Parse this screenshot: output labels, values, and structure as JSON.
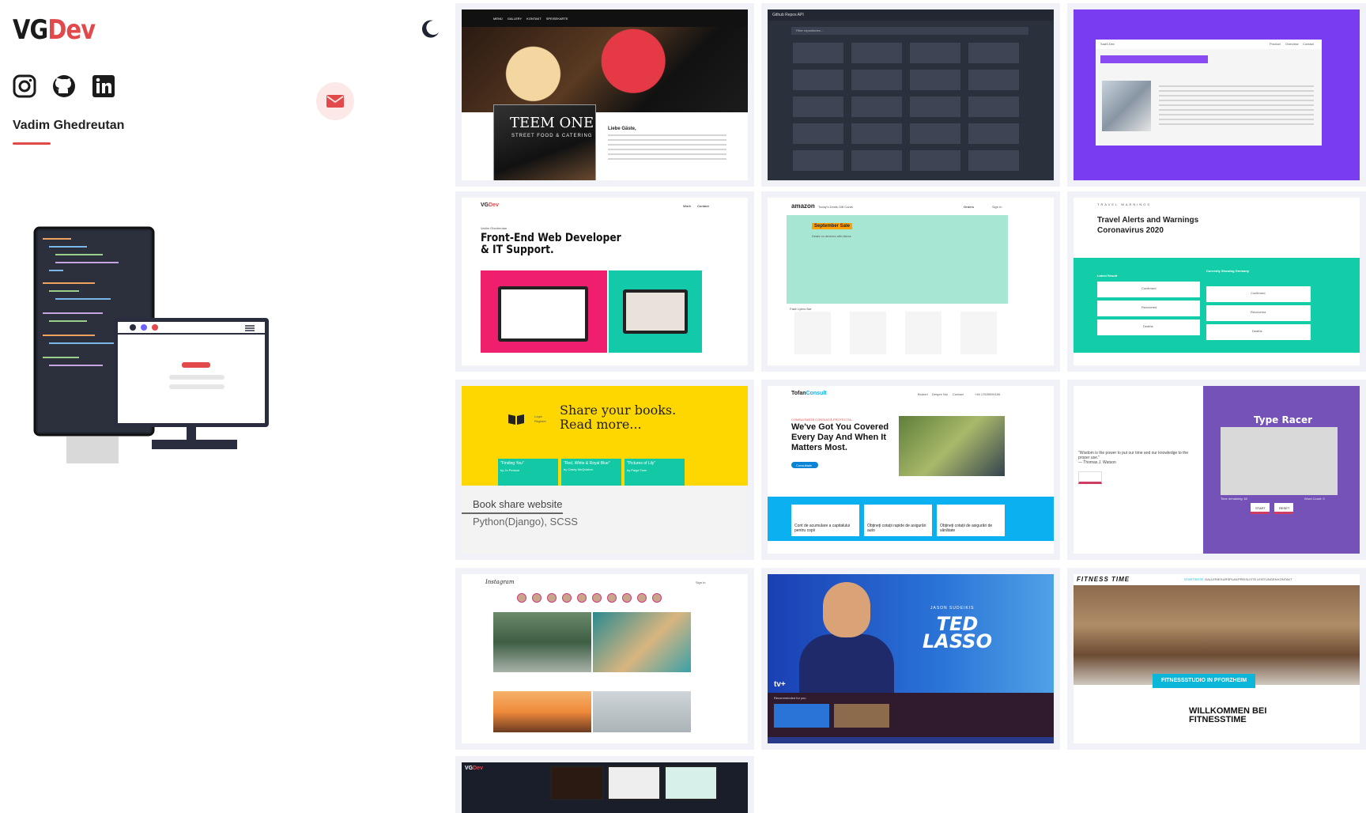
{
  "header": {
    "logo_vg": "VG",
    "logo_dev": "Dev",
    "name": "Vadim Ghedreutan"
  },
  "icons": {
    "theme_toggle": "moon-icon",
    "socials": [
      "instagram-icon",
      "github-icon",
      "linkedin-icon"
    ],
    "contact": "mail-icon"
  },
  "colors": {
    "accent": "#e2494b",
    "mail_bg": "#fde8e8"
  },
  "projects": [
    {
      "id": "restaurant",
      "nav": [
        "MENÜ",
        "GALLERY",
        "KONTAKT",
        "SPEISEKARTE"
      ],
      "brand": "TEEM ONE",
      "brand_sub": "STREET FOOD & CATERING",
      "heading": "Liebe Gäste,"
    },
    {
      "id": "github-api",
      "header": "Github Repos API",
      "search_placeholder": "Filter repositories..."
    },
    {
      "id": "saas-landing",
      "brand": "SaaS.Dev",
      "nav": [
        "Product",
        "Overview",
        "Contact"
      ]
    },
    {
      "id": "portfolio",
      "logo_vg": "VG",
      "logo_dev": "Dev",
      "nav": [
        "Work",
        "Contact"
      ],
      "name": "Vadim Ghedreutan",
      "title_line1": "Front-End Web Developer",
      "title_line2": "& IT Support."
    },
    {
      "id": "amazon-clone",
      "brand": "amazon",
      "nav": [
        "Today's Deals",
        "Gift Cards"
      ],
      "account": [
        "Orders",
        "Sign In"
      ],
      "badge": "September Sale",
      "subtitle": "Deals on devices with Alexa",
      "section": "Fake Lyrics Bar"
    },
    {
      "id": "travel-warnings",
      "kicker": "TRAVEL WARNINGS",
      "title_line1": "Travel Alerts and Warnings",
      "title_line2": "Coronavirus 2020",
      "left_label": "Latest Result",
      "right_label": "Currently Showing Germany",
      "stats": [
        "Confirmed",
        "Recovered",
        "Deaths"
      ]
    },
    {
      "id": "book-share",
      "title_line1": "Share your books.",
      "title_line2": "Read more...",
      "auth": [
        "Login",
        "Register"
      ],
      "books": [
        {
          "title": "\"Finding You\"",
          "author": "by Jo Penson"
        },
        {
          "title": "\"Red, White & Royal Blue\"",
          "author": "by Casey McQuiston"
        },
        {
          "title": "\"Pictures of Lily\"",
          "author": "by Paige Toon"
        }
      ],
      "caption": "Book share website",
      "stack": "Python(Django), SCSS"
    },
    {
      "id": "tofan-consult",
      "brand_a": "Tofan",
      "brand_b": "Consult",
      "nav": [
        "Brokeri",
        "Despre Noi",
        "Contact",
        "+49 17639090106"
      ],
      "kicker": "CONSULTANȚĂ CONSULTĂ PROTECȚIA...",
      "title_line1": "We've Got You Covered",
      "title_line2": "Every Day And When It",
      "title_line3": "Matters Most.",
      "cta": "Consultație",
      "services": [
        "Cont de acumulare a capitalului pentru copii",
        "Obțineți cotații rapide de asigurări auto",
        "Obțineți cotații de asigurări de sănătate"
      ]
    },
    {
      "id": "type-racer",
      "quote": "\"Wisdom is the power to put our time and our knowledge to the proper use.\"",
      "quote_author": "— Thomas J. Watson",
      "title": "Type Racer",
      "time_label": "Time remaining: 60",
      "word_label": "Word Count: 0",
      "buttons": [
        "START",
        "RESET"
      ]
    },
    {
      "id": "instagram-clone",
      "brand": "Instagram",
      "sign_in": "Sign In"
    },
    {
      "id": "ted-lasso",
      "kicker": "JASON SUDEIKIS",
      "title_line1": "TED",
      "title_line2": "LASSO",
      "platform": "tv+",
      "section": "Recommended for you"
    },
    {
      "id": "fitness-time",
      "brand": "FITNESS TIME",
      "nav": [
        "STARTSEITE",
        "GALLERIE",
        "KURSPLAN",
        "PREISLISTE",
        "LEISTUNGEN",
        "KONTAKT"
      ],
      "tag": "FITNESSSTUDIO IN PFORZHEIM",
      "welcome_line1": "WILLKOMMEN BEI",
      "welcome_line2": "FITNESSTIME"
    },
    {
      "id": "vgdev-mini",
      "logo_vg": "VG",
      "logo_dev": "Dev"
    }
  ]
}
